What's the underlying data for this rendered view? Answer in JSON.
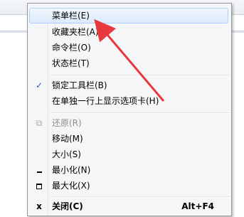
{
  "menu": {
    "items": [
      {
        "label": "菜单栏(E)"
      },
      {
        "label": "收藏夹栏(A)"
      },
      {
        "label": "命令栏(O)"
      },
      {
        "label": "状态栏(T)"
      },
      {
        "label": "锁定工具栏(B)"
      },
      {
        "label": "在单独一行上显示选项卡(H)"
      },
      {
        "label": "还原(R)"
      },
      {
        "label": "移动(M)"
      },
      {
        "label": "大小(S)"
      },
      {
        "label": "最小化(N)"
      },
      {
        "label": "最大化(X)"
      },
      {
        "label": "关闭(C)",
        "shortcut": "Alt+F4"
      }
    ]
  },
  "icons": {
    "check": "checkmark-icon",
    "restore": "restore-icon",
    "minimize": "minimize-icon",
    "maximize": "maximize-icon",
    "close": "close-icon"
  },
  "annotation": {
    "color": "#e8383d"
  }
}
